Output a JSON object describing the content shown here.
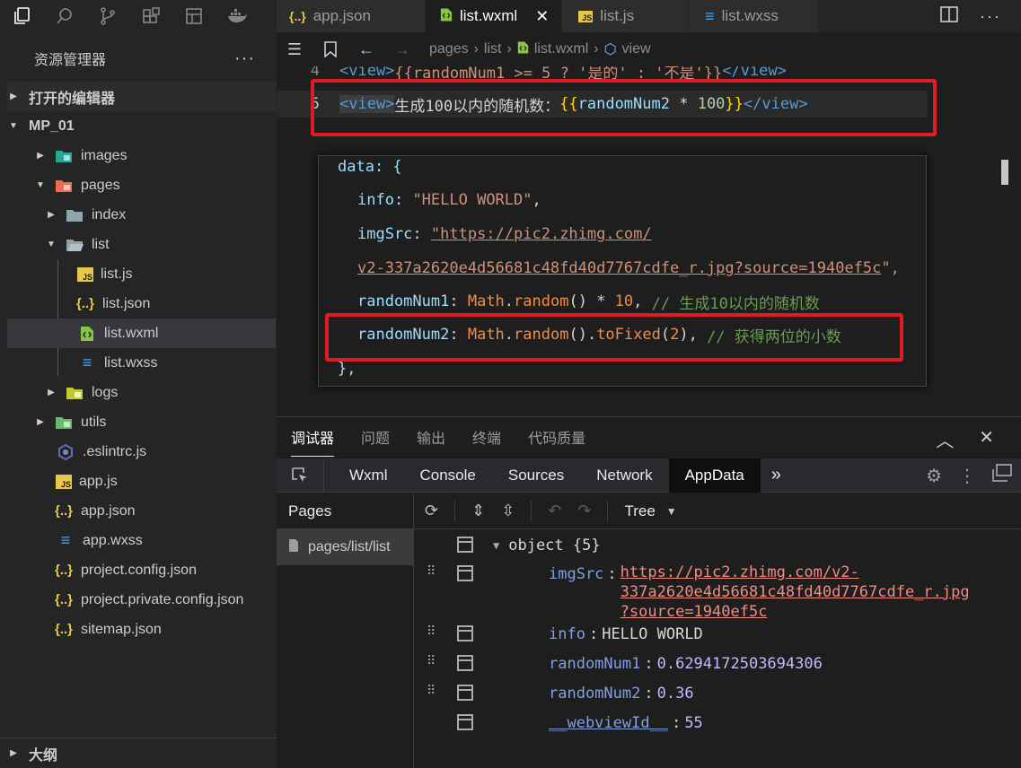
{
  "sidebar": {
    "explorer_title": "资源管理器",
    "more": "···",
    "open_editors": "打开的编辑器",
    "project": "MP_01",
    "items": [
      {
        "label": "images"
      },
      {
        "label": "pages"
      },
      {
        "label": "index"
      },
      {
        "label": "list"
      },
      {
        "label": "list.js"
      },
      {
        "label": "list.json"
      },
      {
        "label": "list.wxml"
      },
      {
        "label": "list.wxss"
      },
      {
        "label": "logs"
      },
      {
        "label": "utils"
      },
      {
        "label": ".eslintrc.js"
      },
      {
        "label": "app.js"
      },
      {
        "label": "app.json"
      },
      {
        "label": "app.wxss"
      },
      {
        "label": "project.config.json"
      },
      {
        "label": "project.private.config.json"
      },
      {
        "label": "sitemap.json"
      }
    ],
    "outline": "大纲"
  },
  "tabs": [
    {
      "icon": "{..}",
      "label": "app.json"
    },
    {
      "icon": "<>",
      "label": "list.wxml",
      "close": "✕"
    },
    {
      "icon": "JS",
      "label": "list.js"
    },
    {
      "icon": "≡",
      "label": "list.wxss"
    }
  ],
  "breadcrumb": {
    "a": "pages",
    "b": "list",
    "c": "list.wxml",
    "d": "view"
  },
  "editor": {
    "line4_num": "4",
    "line4_open": "<view>",
    "line4_expr": "{{randomNum1 >= 5 ? '是的' : '不是'}}",
    "line4_close": "</view>",
    "line5_num": "5",
    "line5_open": "<view>",
    "line5_text": "生成100以内的随机数：",
    "line5_b1": "{{",
    "line5_var": "randomNum2",
    "line5_op": " * ",
    "line5_num100": "100",
    "line5_b2": "}}",
    "line5_close": "</view>"
  },
  "popup": {
    "data_open": "data: {",
    "info_key": "info",
    "info_val": "\"HELLO WORLD\"",
    "img_key": "imgSrc",
    "img_val1": "\"https://pic2.zhimg.com/",
    "img_val2": "v2-337a2620e4d56681c48fd40d7767cdfe_r.jpg?source=1940ef5c",
    "img_end": "\",",
    "r1_key": "randomNum1",
    "r1_math": "Math",
    "r1_fn": "random",
    "r1_rest": " * ",
    "r1_num": "10",
    "r1_cmt": "// 生成10以内的随机数",
    "r2_key": "randomNum2",
    "r2_math": "Math",
    "r2_fn": "random",
    "r2_fn2": "toFixed",
    "r2_num": "2",
    "r2_cmt": "// 获得两位的小数",
    "data_close": "},"
  },
  "panel": {
    "tabs": [
      "调试器",
      "问题",
      "输出",
      "终端",
      "代码质量"
    ],
    "devtabs": [
      "Wxml",
      "Console",
      "Sources",
      "Network",
      "AppData"
    ],
    "more": "»",
    "pages_head": "Pages",
    "pages_item": "pages/list/list",
    "tree_mode": "Tree",
    "root": "object {5}",
    "rows": [
      {
        "key": "imgSrc",
        "val1": "https://pic2.zhimg.com/v2-",
        "val2": "337a2620e4d56681c48fd40d7767cdfe_r.jpg",
        "val3": "?source=1940ef5c"
      },
      {
        "key": "info",
        "val": "HELLO WORLD"
      },
      {
        "key": "randomNum1",
        "val": "0.6294172503694306"
      },
      {
        "key": "randomNum2",
        "val": "0.36"
      },
      {
        "key": "__webviewId__",
        "val": "55"
      }
    ]
  },
  "colors": {
    "highlight": "#e01b24",
    "background": "#1e1e1e"
  }
}
